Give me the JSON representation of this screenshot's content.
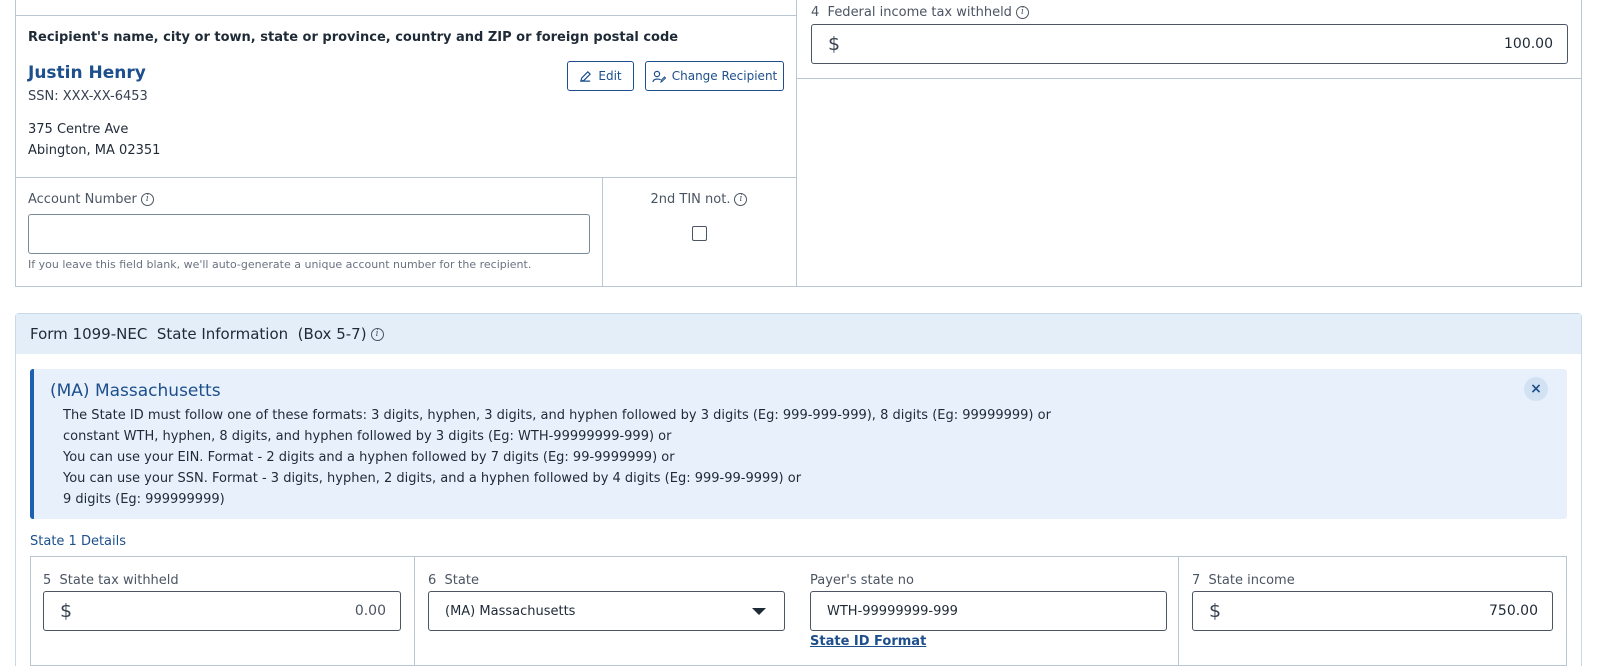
{
  "recipient": {
    "section_label": "Recipient's name, city or town, state or province, country and ZIP or foreign postal code",
    "name": "Justin Henry",
    "ssn": "SSN: XXX-XX-6453",
    "address_line1": "375 Centre Ave",
    "address_line2": "Abington, MA 02351",
    "edit_label": "Edit",
    "change_label": "Change Recipient"
  },
  "account": {
    "label": "Account Number",
    "value": "",
    "hint": "If you leave this field blank, we'll auto-generate a unique account number for the recipient."
  },
  "tin": {
    "label": "2nd TIN not.",
    "checked": false
  },
  "box4": {
    "number": "4",
    "label": "Federal income tax withheld",
    "currency": "$",
    "value": "100.00"
  },
  "state_section": {
    "title": "Form 1099-NEC  State Information  (Box 5-7)",
    "notice": {
      "title": "(MA) Massachusetts",
      "lines": [
        "The State ID must follow one of these formats: 3 digits, hyphen, 3 digits, and hyphen followed by 3 digits (Eg: 999-999-999), 8 digits (Eg: 99999999) or",
        "constant WTH, hyphen, 8 digits, and hyphen followed by 3 digits (Eg: WTH-99999999-999) or",
        "You can use your EIN. Format - 2 digits and a hyphen followed by 7 digits (Eg: 99-9999999) or",
        "You can use your SSN. Format - 3 digits, hyphen, 2 digits, and a hyphen followed by 4 digits (Eg: 999-99-9999) or",
        "9 digits (Eg: 999999999)"
      ],
      "close_symbol": "×"
    },
    "state1_label": "State 1 Details",
    "box5": {
      "number": "5",
      "label": "State tax withheld",
      "currency": "$",
      "value": "0.00"
    },
    "box6": {
      "number": "6",
      "label": "State",
      "selected": "(MA) Massachusetts"
    },
    "payer_state_no": {
      "label": "Payer's state no",
      "value": "WTH-99999999-999",
      "link": "State ID Format"
    },
    "box7": {
      "number": "7",
      "label": "State income",
      "currency": "$",
      "value": "750.00"
    }
  },
  "colors": {
    "accent": "#1d4f8c",
    "notice_bg": "#e8f1fb",
    "header_bg": "#e3eef9",
    "border": "#b9c6d3"
  }
}
